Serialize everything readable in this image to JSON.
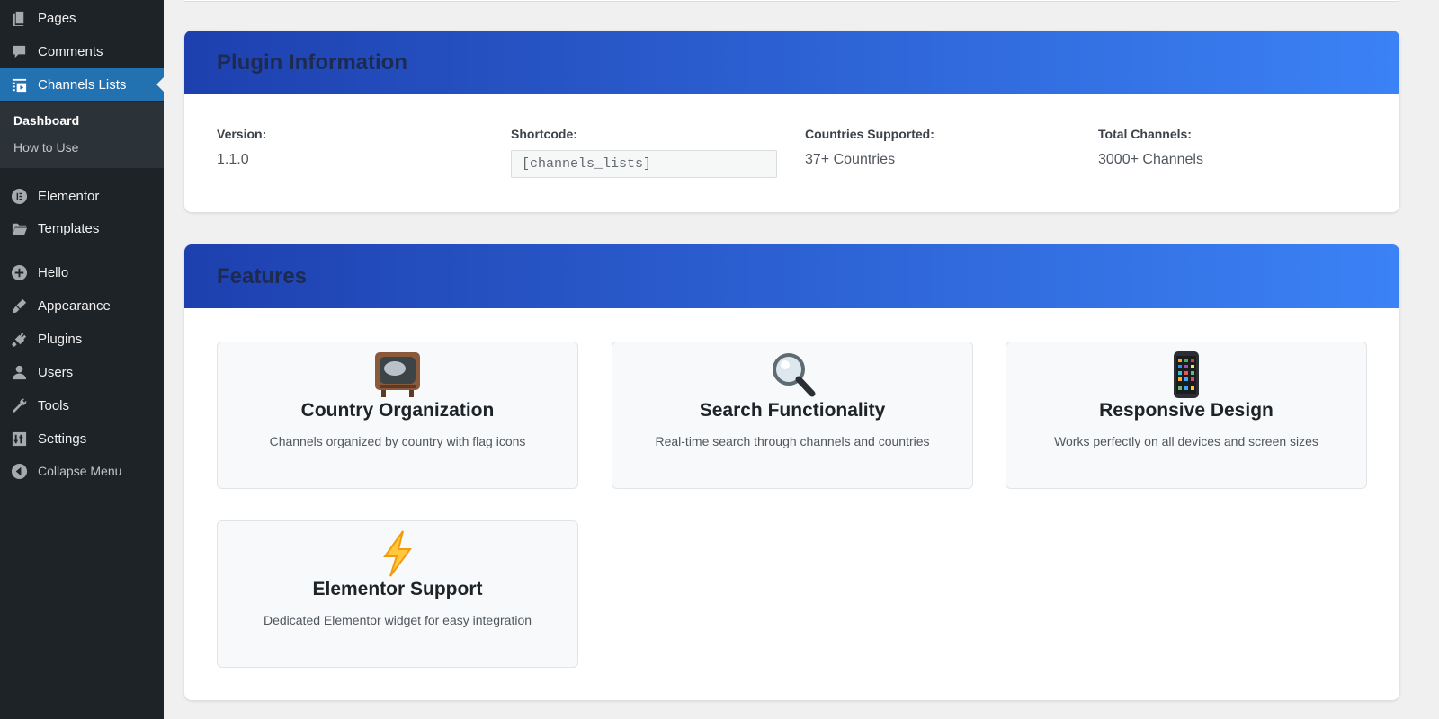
{
  "sidebar": {
    "items": [
      {
        "label": "Pages",
        "icon": "pages-icon"
      },
      {
        "label": "Comments",
        "icon": "comments-icon"
      },
      {
        "label": "Channels Lists",
        "icon": "channels-list-icon",
        "active": true
      },
      {
        "label": "Elementor",
        "icon": "elementor-icon"
      },
      {
        "label": "Templates",
        "icon": "folder-icon"
      },
      {
        "label": "Hello",
        "icon": "plus-circle-icon"
      },
      {
        "label": "Appearance",
        "icon": "paintbrush-icon"
      },
      {
        "label": "Plugins",
        "icon": "plug-icon"
      },
      {
        "label": "Users",
        "icon": "user-icon"
      },
      {
        "label": "Tools",
        "icon": "wrench-icon"
      },
      {
        "label": "Settings",
        "icon": "settings-icon"
      },
      {
        "label": "Collapse Menu",
        "icon": "collapse-icon"
      }
    ],
    "submenu": [
      {
        "label": "Dashboard",
        "current": true
      },
      {
        "label": "How to Use"
      }
    ]
  },
  "plugin_info": {
    "title": "Plugin Information",
    "version_label": "Version:",
    "version_value": "1.1.0",
    "shortcode_label": "Shortcode:",
    "shortcode_value": "[channels_lists]",
    "countries_label": "Countries Supported:",
    "countries_value": "37+ Countries",
    "channels_label": "Total Channels:",
    "channels_value": "3000+ Channels"
  },
  "features": {
    "title": "Features",
    "cards": [
      {
        "icon": "tv-icon",
        "title": "Country Organization",
        "desc": "Channels organized by country with flag icons"
      },
      {
        "icon": "magnifier-icon",
        "title": "Search Functionality",
        "desc": "Real-time search through channels and countries"
      },
      {
        "icon": "mobile-phone-icon",
        "title": "Responsive Design",
        "desc": "Works perfectly on all devices and screen sizes"
      },
      {
        "icon": "lightning-icon",
        "title": "Elementor Support",
        "desc": "Dedicated Elementor widget for easy integration"
      }
    ]
  },
  "colors": {
    "sidebar_bg": "#1d2327",
    "active_blue": "#2271b1",
    "header_gradient_start": "#1e40af",
    "header_gradient_end": "#3b82f6"
  }
}
